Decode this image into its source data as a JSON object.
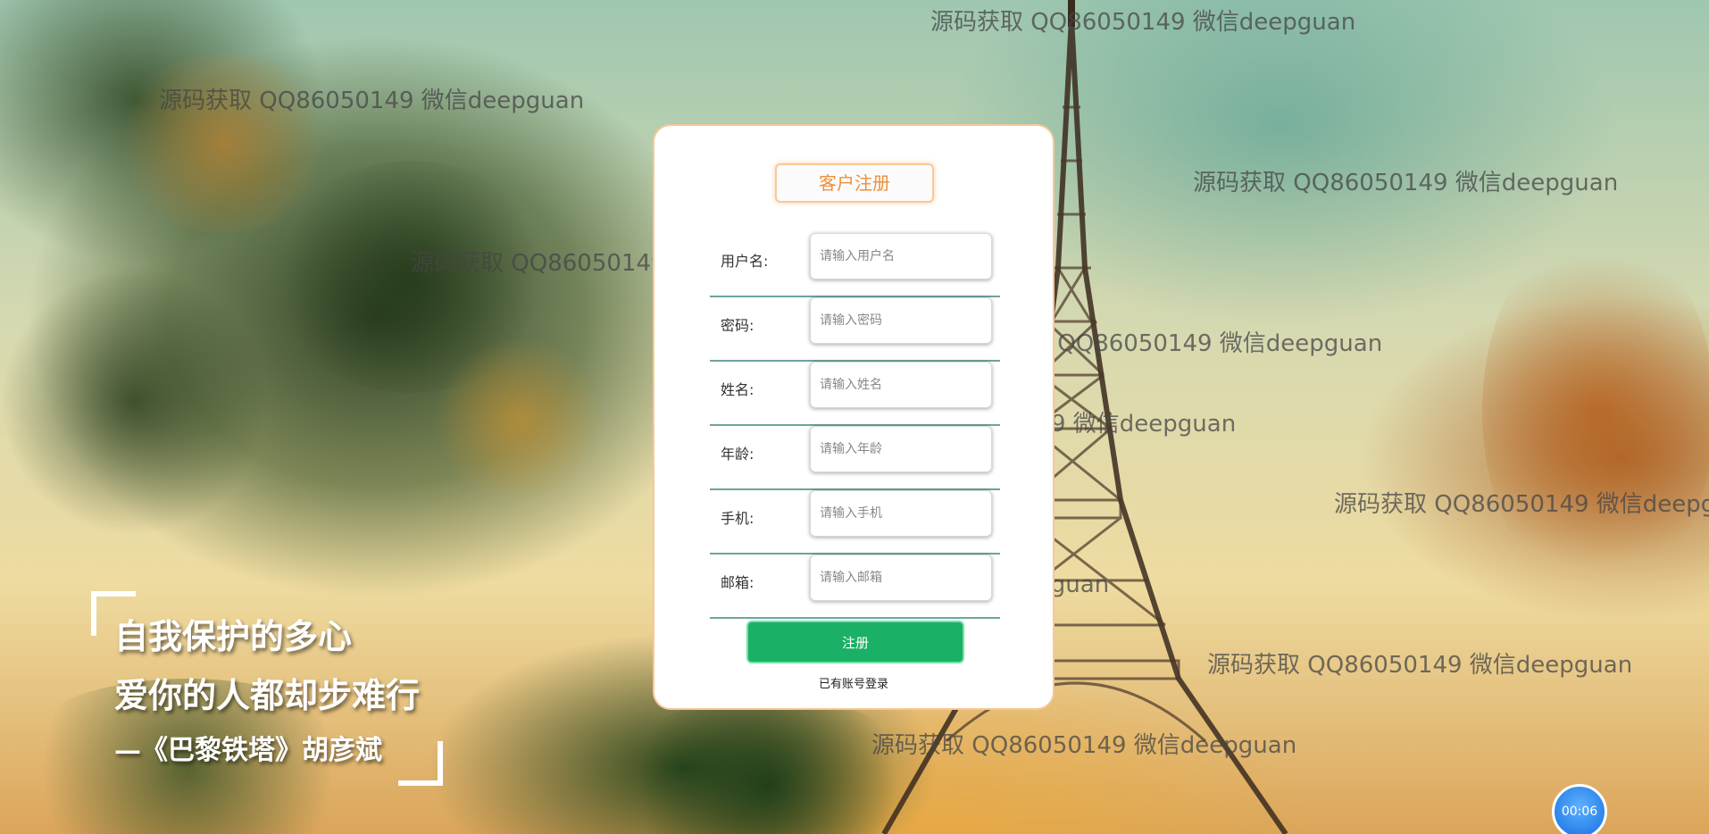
{
  "form": {
    "title": "客户注册",
    "fields": [
      {
        "label": "用户名:",
        "placeholder": "请输入用户名",
        "value": ""
      },
      {
        "label": "密码:",
        "placeholder": "请输入密码",
        "value": ""
      },
      {
        "label": "姓名:",
        "placeholder": "请输入姓名",
        "value": ""
      },
      {
        "label": "年龄:",
        "placeholder": "请输入年龄",
        "value": ""
      },
      {
        "label": "手机:",
        "placeholder": "请输入手机",
        "value": ""
      },
      {
        "label": "邮箱:",
        "placeholder": "请输入邮箱",
        "value": ""
      }
    ],
    "submit_label": "注册",
    "login_link": "已有账号登录"
  },
  "poem": {
    "line1": "自我保护的多心",
    "line2": "爱你的人都却步难行",
    "signature": "—《巴黎铁塔》胡彦斌"
  },
  "watermark_text": "源码获取 QQ86050149 微信deepguan",
  "timer": "00:06",
  "colors": {
    "accent_orange": "#ee8f3a",
    "button_green": "#1ab065",
    "row_divider": "#6fa39d",
    "timer_blue": "#2b83e8"
  }
}
